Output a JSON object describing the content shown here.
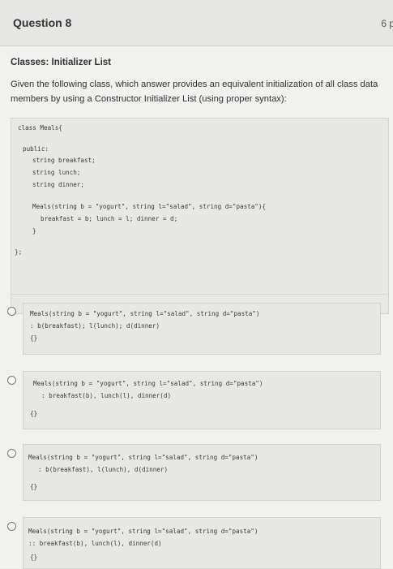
{
  "question": {
    "title": "Question 8",
    "points": "6 p"
  },
  "section_title": "Classes: Initializer List",
  "prompt": "Given the following class, which answer provides an equivalent initialization of all class data members by using a Constructor Initializer List (using proper syntax):",
  "code": {
    "class_decl": "class Meals{",
    "public": "public:",
    "member1": "string breakfast;",
    "member2": "string lunch;",
    "member3": "string dinner;",
    "ctor": "Meals(string b = \"yogurt\", string l=\"salad\", string d=\"pasta\"){",
    "body": "breakfast = b; lunch = l; dinner = d;",
    "close_brace": "}",
    "end": "};"
  },
  "answers": [
    {
      "line1": "Meals(string b = \"yogurt\", string l=\"salad\", string d=\"pasta\")",
      "line2": ": b(breakfast); l(lunch); d(dinner)",
      "line3": "{}"
    },
    {
      "line1": "Meals(string b = \"yogurt\", string l=\"salad\", string d=\"pasta\")",
      "line2": ": breakfast(b), lunch(l), dinner(d)",
      "line3": "{}"
    },
    {
      "line1": "Meals(string b = \"yogurt\", string l=\"salad\", string d=\"pasta\")",
      "line2": ": b(breakfast), l(lunch), d(dinner)",
      "line3": "{}"
    },
    {
      "line1": "Meals(string b = \"yogurt\", string l=\"salad\", string d=\"pasta\")",
      "line2": ":: breakfast(b), lunch(l), dinner(d)",
      "line3": "{}"
    }
  ]
}
